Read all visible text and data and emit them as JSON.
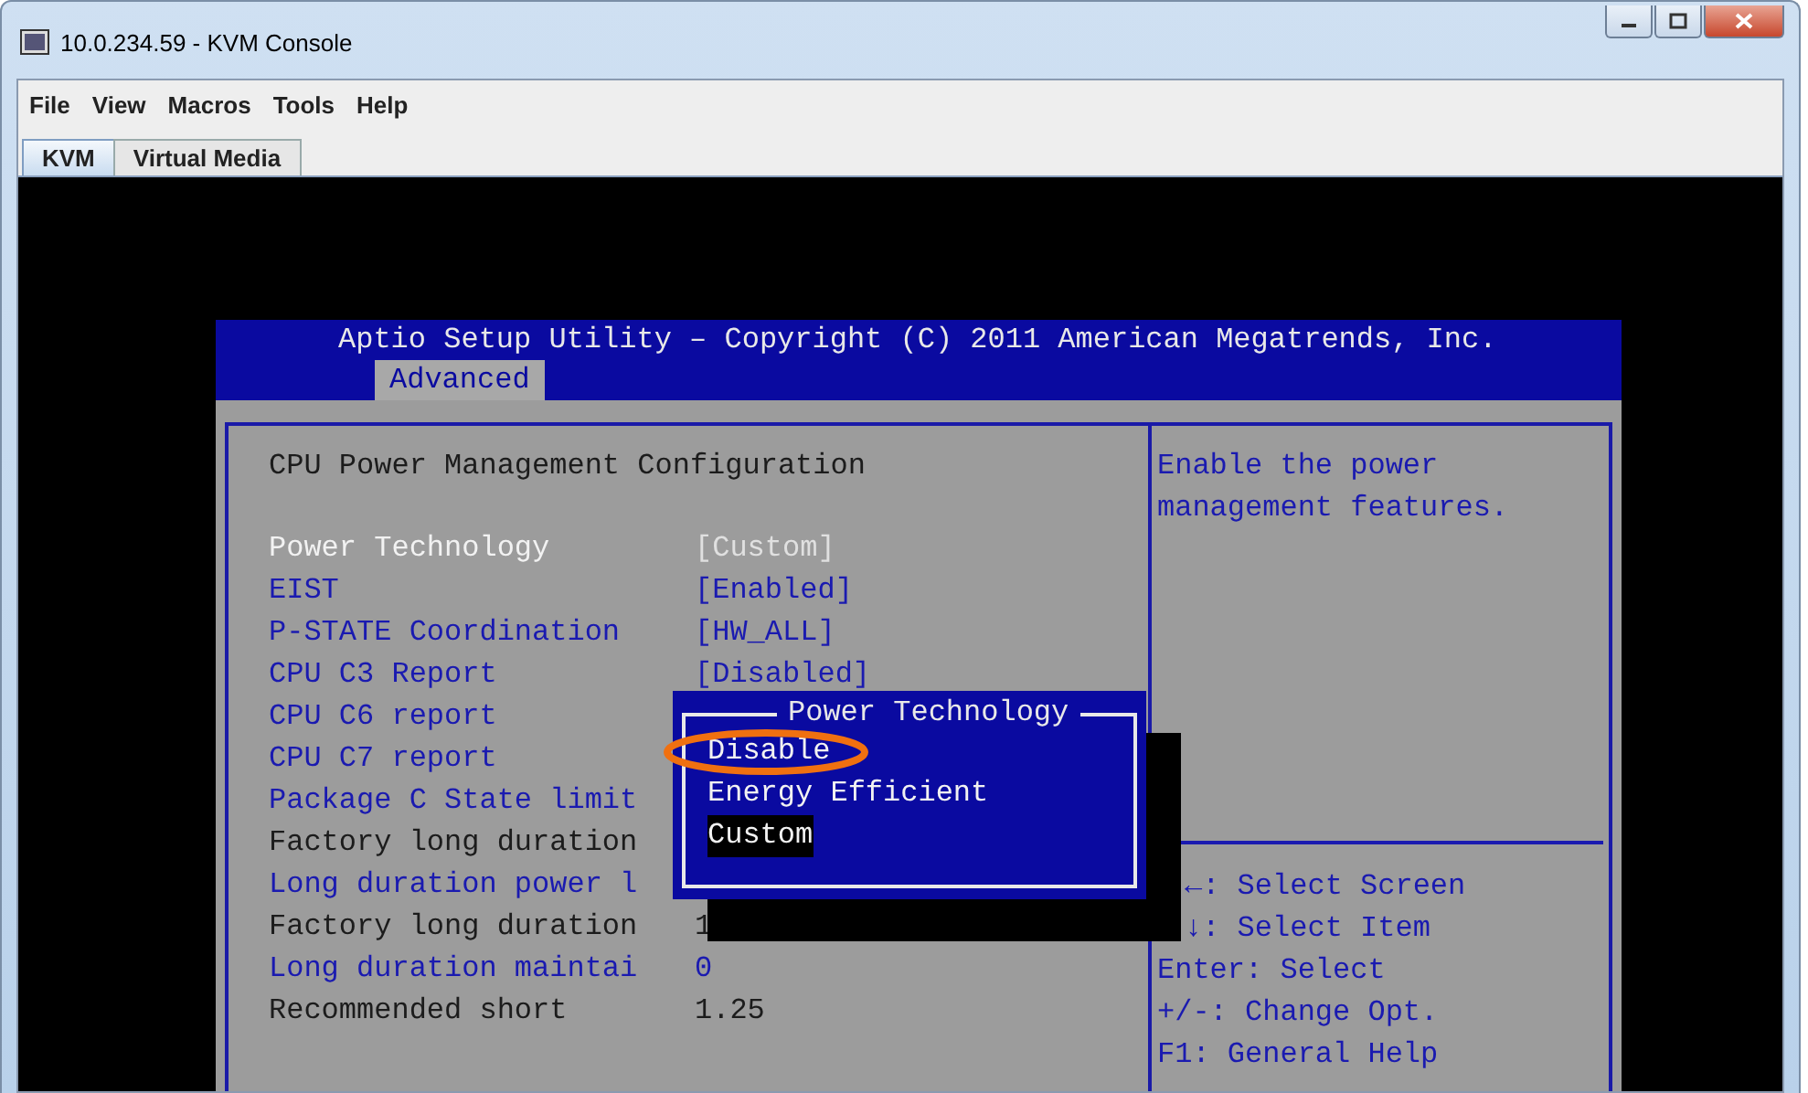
{
  "window": {
    "title": "10.0.234.59 - KVM Console"
  },
  "menu": [
    "File",
    "View",
    "Macros",
    "Tools",
    "Help"
  ],
  "tabs": [
    {
      "label": "KVM",
      "selected": true
    },
    {
      "label": "Virtual Media",
      "selected": false
    }
  ],
  "bios": {
    "title": "Aptio Setup Utility – Copyright (C) 2011 American Megatrends, Inc.",
    "tabs": [
      {
        "label": "Advanced",
        "selected": true
      }
    ],
    "heading": "CPU Power Management Configuration",
    "settings": [
      {
        "label": "Power Technology",
        "value": "[Custom]",
        "selected": true,
        "read_only": false
      },
      {
        "label": "EIST",
        "value": "[Enabled]",
        "selected": false,
        "read_only": false
      },
      {
        "label": "P-STATE Coordination",
        "value": "[HW_ALL]",
        "selected": false,
        "read_only": false
      },
      {
        "label": "CPU C3 Report",
        "value": "[Disabled]",
        "selected": false,
        "read_only": false
      },
      {
        "label": "CPU C6 report",
        "selected": false,
        "read_only": false
      },
      {
        "label": "CPU C7 report",
        "selected": false,
        "read_only": false
      },
      {
        "label": "Package C State limit",
        "selected": false,
        "read_only": false
      },
      {
        "label": "Factory long duration",
        "selected": false,
        "read_only": true
      },
      {
        "label": "Long duration power l",
        "selected": false,
        "read_only": false
      },
      {
        "label": "Factory long duration",
        "value": "1",
        "selected": false,
        "read_only": true
      },
      {
        "label": "Long duration maintai",
        "value": "0",
        "selected": false,
        "read_only": false
      },
      {
        "label": "Recommended short",
        "value": "1.25",
        "selected": false,
        "read_only": true
      }
    ],
    "help": "Enable the power management features.",
    "keys": [
      "←: Select Screen",
      "↓: Select Item",
      "Enter: Select",
      "+/-: Change Opt.",
      "F1: General Help"
    ],
    "popup": {
      "title": "Power Technology",
      "options": [
        {
          "label": "Disable",
          "selected": false,
          "circled": true
        },
        {
          "label": "Energy Efficient",
          "selected": false,
          "circled": false
        },
        {
          "label": "Custom",
          "selected": true,
          "circled": false
        }
      ]
    }
  }
}
